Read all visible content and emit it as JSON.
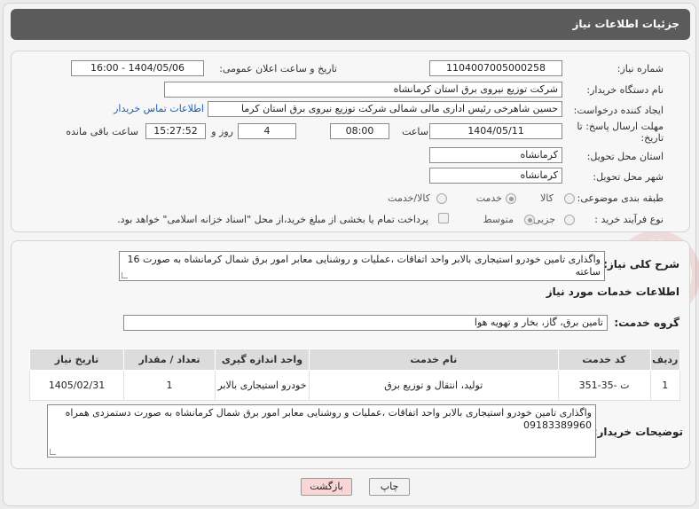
{
  "header": {
    "title": "جزئیات اطلاعات نیاز"
  },
  "need": {
    "number_label": "شماره نیاز:",
    "number": "1104007005000258",
    "announce_label": "تاریخ و ساعت اعلان عمومی:",
    "announce": "1404/05/06 - 16:00",
    "buyer_label": "نام دستگاه خریدار:",
    "buyer": "شرکت توزیع نیروی برق استان کرمانشاه",
    "creator_label": "ایجاد کننده درخواست:",
    "creator": "حسین شاهرخی رئیس اداری مالی شمالی شرکت توزیع نیروی برق استان کرما",
    "contact_link": "اطلاعات تماس خریدار",
    "deadline_label_1": "مهلت ارسال پاسخ: تا",
    "deadline_label_2": "تاریخ:",
    "deadline_date": "1404/05/11",
    "time_label": "ساعت",
    "deadline_time": "08:00",
    "days": "4",
    "days_label": "روز و",
    "remaining": "15:27:52",
    "remaining_label": "ساعت باقی مانده",
    "province_label": "استان محل تحویل:",
    "province": "کرمانشاه",
    "city_label": "شهر محل تحویل:",
    "city": "کرمانشاه",
    "category_label": "طبقه بندی موضوعی:",
    "category_options": [
      "کالا",
      "خدمت",
      "کالا/خدمت"
    ],
    "process_label": "نوع فرآیند خرید :",
    "process_options": [
      "جزیی",
      "متوسط"
    ],
    "payment_text": "پرداخت تمام یا بخشی از مبلغ خرید،از محل \"اسناد خزانه اسلامی\" خواهد بود."
  },
  "summary": {
    "label": "شرح کلی نیاز:",
    "text": "واگذاری تامین خودرو استیجاری بالابر واحد اتفاقات ،عملیات و روشنایی معابر امور برق شمال کرمانشاه  به صورت 16 ساعته"
  },
  "services": {
    "section_title": "اطلاعات خدمات مورد نیاز",
    "group_label": "گروه خدمت:",
    "group": "تامین برق، گاز، بخار و تهویه هوا",
    "columns": [
      "ردیف",
      "کد خدمت",
      "نام خدمت",
      "واحد اندازه گیری",
      "تعداد / مقدار",
      "تاریخ نیاز"
    ],
    "rows": [
      {
        "row": "1",
        "code": "ت -35-351",
        "name": "تولید، انتقال و توزیع برق",
        "unit": "خودرو استیجاری بالابر",
        "qty": "1",
        "date": "1405/02/31"
      }
    ]
  },
  "buyer_notes": {
    "label": "توضیحات خریدار:",
    "text": "واگذاری تامین خودرو استیجاری بالابر واحد اتفاقات ،عملیات و روشنایی معابر امور برق شمال کرمانشاه  به صورت دستمزدی همراه 09183389960"
  },
  "buttons": {
    "print": "چاپ",
    "back": "بازگشت"
  },
  "colors": {
    "header_bg": "#5b5b5b",
    "link": "#1a5fb4",
    "back_btn": "#f8d6d6"
  }
}
